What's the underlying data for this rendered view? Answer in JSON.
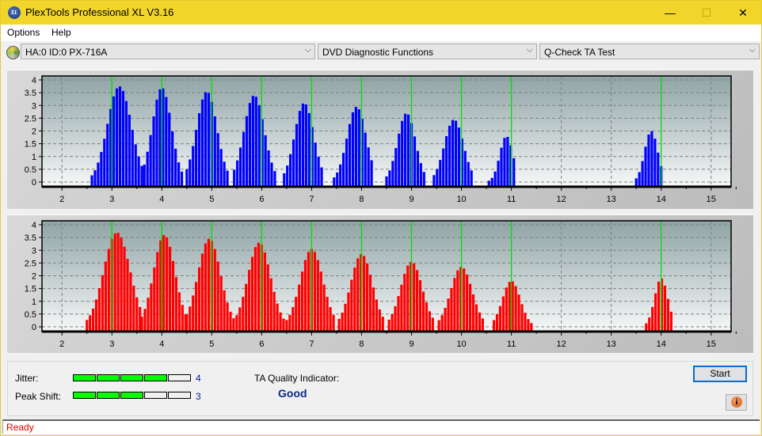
{
  "window": {
    "title": "PlexTools Professional XL V3.16",
    "icon": "xl-logo-icon",
    "controls": {
      "minimize": "—",
      "maximize": "☐",
      "close": "✕"
    }
  },
  "menu": [
    {
      "label": "Options"
    },
    {
      "label": "Help"
    }
  ],
  "toolbar": {
    "drive_icon": "disc-icon",
    "drive": "HA:0 ID:0  PX-716A",
    "function_group": "DVD Diagnostic Functions",
    "test": "Q-Check TA Test",
    "chevron": "⌵"
  },
  "bottom": {
    "jitter_label": "Jitter:",
    "jitter_value": "4",
    "jitter_level": 4,
    "peak_shift_label": "Peak Shift:",
    "peak_shift_value": "3",
    "peak_shift_level": 3,
    "scale_max": 5,
    "ta_quality_label": "TA Quality Indicator:",
    "ta_quality_value": "Good",
    "start_label": "Start",
    "info_icon": "i"
  },
  "status": {
    "text": "Ready"
  },
  "colors": {
    "on": "#00ff00",
    "off": "#f0f0f0",
    "blue": "#0000ff",
    "red": "#ff0000",
    "marker": "#00e000"
  },
  "chart_data": [
    {
      "type": "bar",
      "name": "TA histogram (upper / lands)",
      "color": "#0000ff",
      "xlim": [
        1.6,
        15.4
      ],
      "ylim": [
        0,
        4.2
      ],
      "xticks": [
        2,
        3,
        4,
        5,
        6,
        7,
        8,
        9,
        10,
        11,
        12,
        13,
        14,
        15
      ],
      "yticks": [
        "0",
        "0.5",
        "1",
        "1.5",
        "2",
        "2.5",
        "3",
        "3.5",
        "4"
      ],
      "markers": [
        3,
        4,
        5,
        6,
        7,
        8,
        9,
        10,
        11,
        14
      ],
      "peaks": [
        {
          "center": 3.15,
          "height": 3.75,
          "from": 2.6,
          "to": 3.6
        },
        {
          "center": 4.0,
          "height": 3.7,
          "from": 3.65,
          "to": 4.45
        },
        {
          "center": 4.9,
          "height": 3.55,
          "from": 4.5,
          "to": 5.35
        },
        {
          "center": 5.85,
          "height": 3.4,
          "from": 5.45,
          "to": 6.3
        },
        {
          "center": 6.85,
          "height": 3.1,
          "from": 6.45,
          "to": 7.25
        },
        {
          "center": 7.9,
          "height": 2.95,
          "from": 7.45,
          "to": 8.25
        },
        {
          "center": 8.9,
          "height": 2.7,
          "from": 8.5,
          "to": 9.25
        },
        {
          "center": 9.85,
          "height": 2.45,
          "from": 9.45,
          "to": 10.25
        },
        {
          "center": 10.9,
          "height": 1.8,
          "from": 10.55,
          "to": 11.1
        },
        {
          "center": 13.8,
          "height": 2.0,
          "from": 13.5,
          "to": 14.05
        }
      ]
    },
    {
      "type": "bar",
      "name": "TA histogram (lower / pits)",
      "color": "#ff0000",
      "xlim": [
        1.6,
        15.4
      ],
      "ylim": [
        0,
        4.2
      ],
      "xticks": [
        2,
        3,
        4,
        5,
        6,
        7,
        8,
        9,
        10,
        11,
        12,
        13,
        14,
        15
      ],
      "yticks": [
        "0",
        "0.5",
        "1",
        "1.5",
        "2",
        "2.5",
        "3",
        "3.5",
        "4"
      ],
      "markers": [
        3,
        4,
        5,
        6,
        7,
        8,
        9,
        10,
        11,
        14
      ],
      "peaks": [
        {
          "center": 3.1,
          "height": 3.7,
          "from": 2.5,
          "to": 3.6
        },
        {
          "center": 4.05,
          "height": 3.6,
          "from": 3.6,
          "to": 4.5
        },
        {
          "center": 4.95,
          "height": 3.45,
          "from": 4.5,
          "to": 5.45
        },
        {
          "center": 5.95,
          "height": 3.3,
          "from": 5.5,
          "to": 6.45
        },
        {
          "center": 7.0,
          "height": 3.05,
          "from": 6.5,
          "to": 7.45
        },
        {
          "center": 8.0,
          "height": 2.85,
          "from": 7.55,
          "to": 8.45
        },
        {
          "center": 9.0,
          "height": 2.55,
          "from": 8.55,
          "to": 9.45
        },
        {
          "center": 10.0,
          "height": 2.35,
          "from": 9.55,
          "to": 10.45
        },
        {
          "center": 11.0,
          "height": 1.8,
          "from": 10.65,
          "to": 11.4
        },
        {
          "center": 14.0,
          "height": 1.9,
          "from": 13.7,
          "to": 14.25
        }
      ]
    }
  ]
}
